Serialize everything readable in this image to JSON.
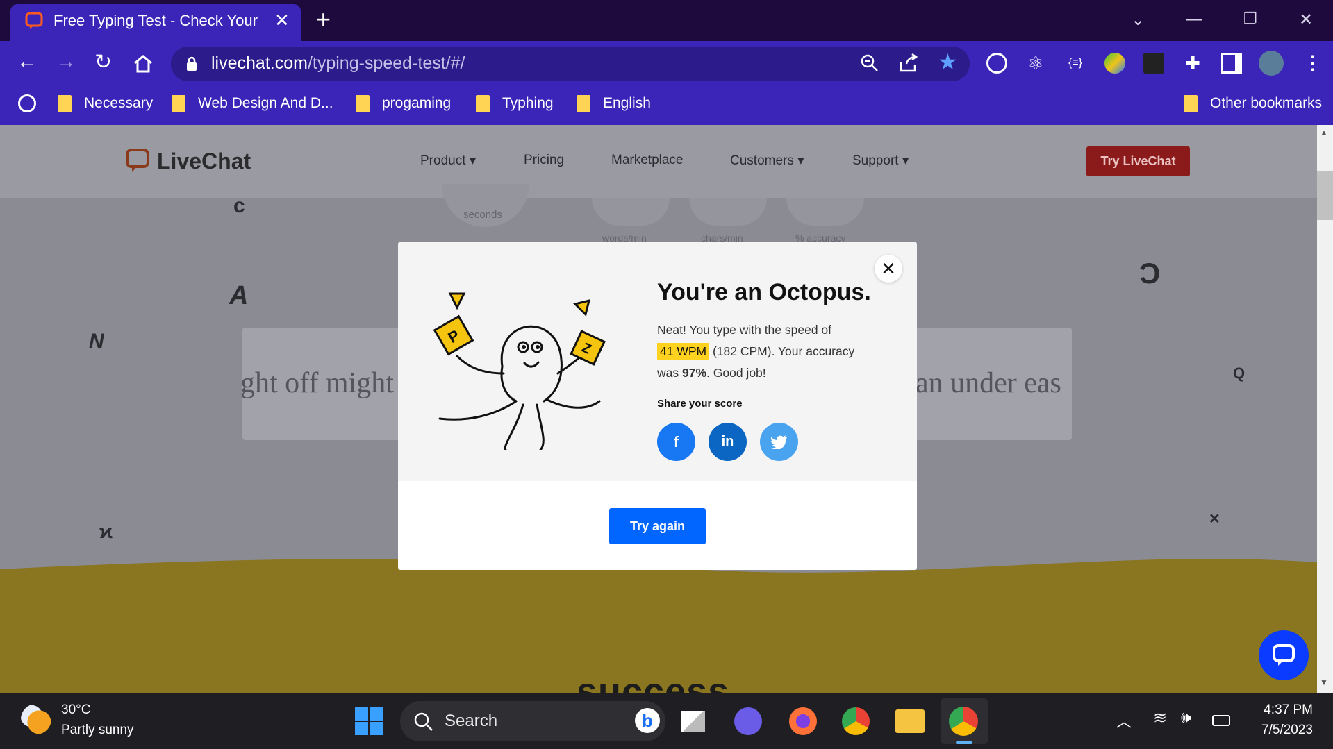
{
  "browser": {
    "tab_title": "Free Typing Test - Check Your Typ",
    "url_domain": "livechat.com",
    "url_path": "/typing-speed-test/#/",
    "bookmarks": [
      "Necessary",
      "Web Design And D...",
      "progaming",
      "Typhing",
      "English"
    ],
    "other_bookmarks": "Other bookmarks"
  },
  "site": {
    "logo_text": "LiveChat",
    "nav": [
      "Product",
      "Pricing",
      "Marketplace",
      "Customers",
      "Support"
    ],
    "cta": "Try LiveChat",
    "stats": {
      "seconds_label": "seconds",
      "wpm_label": "words/min",
      "cpm_label": "chars/min",
      "accuracy_label": "% accuracy"
    },
    "typing_left": "ght off might",
    "typing_right": "an under eas",
    "section_heading": "success"
  },
  "modal": {
    "title": "You're an Octopus.",
    "body_prefix": "Neat! You type with the speed of",
    "wpm": "41 WPM",
    "cpm": "(182 CPM). Your accuracy",
    "was": "was",
    "accuracy": "97%",
    "good_job": ". Good job!",
    "share_label": "Share your score",
    "share_buttons": {
      "facebook": "f",
      "linkedin": "in",
      "twitter": "t"
    },
    "try_again": "Try again"
  },
  "taskbar": {
    "weather_temp": "30°C",
    "weather_desc": "Partly sunny",
    "search_placeholder": "Search",
    "time": "4:37 PM",
    "date": "7/5/2023"
  },
  "colors": {
    "tab_bar": "#1e0a3c",
    "toolbar": "#3a25b8",
    "overlay_bg": "#8b8b94",
    "wave": "#8a7520",
    "primary": "#0066ff",
    "highlight": "#ffd21f"
  }
}
